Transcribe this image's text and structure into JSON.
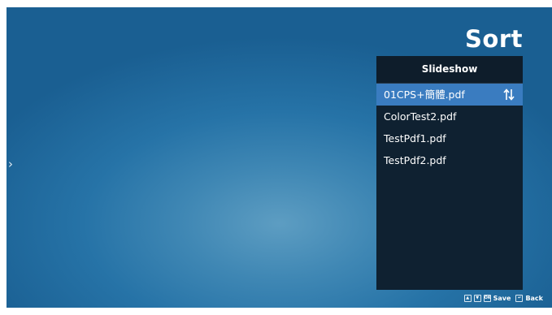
{
  "screen": {
    "title": "Sort",
    "left_arrow": "›"
  },
  "panel": {
    "header": "Slideshow",
    "items": [
      {
        "label": "01CPS+簡體.pdf",
        "selected": true
      },
      {
        "label": "ColorTest2.pdf",
        "selected": false
      },
      {
        "label": "TestPdf1.pdf",
        "selected": false
      },
      {
        "label": "TestPdf2.pdf",
        "selected": false
      }
    ]
  },
  "footer": {
    "up_key": "▲",
    "down_key": "▼",
    "ok_key": "OK",
    "save_label": "Save",
    "back_key": "↵",
    "back_label": "Back"
  },
  "colors": {
    "selected_row": "#3a7cc0",
    "panel_bg": "#0f2131"
  }
}
